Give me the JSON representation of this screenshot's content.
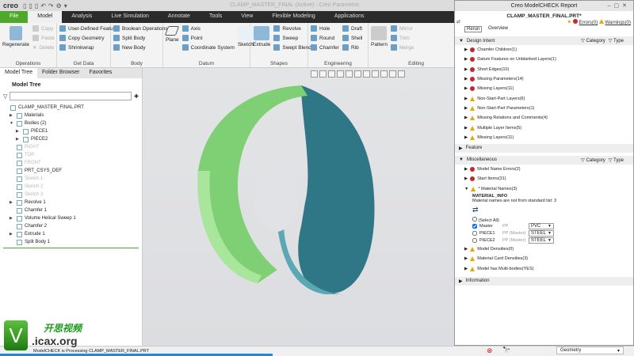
{
  "app": {
    "logo": "creo",
    "window_title": "CLAMP_MASTER_FINAL (Active) - Creo Parametric"
  },
  "tabs": [
    "File",
    "Model",
    "Analysis",
    "Live Simulation",
    "Annotate",
    "Tools",
    "View",
    "Flexible Modeling",
    "Applications"
  ],
  "ribbon": {
    "operations": {
      "label": "Operations",
      "regenerate": "Regenerate",
      "copy": "Copy",
      "paste": "Paste",
      "delete": "Delete"
    },
    "get_data": {
      "label": "Get Data",
      "items": [
        "User-Defined Feature",
        "Copy Geometry",
        "Shrinkwrap"
      ]
    },
    "body": {
      "label": "Body",
      "items": [
        "Boolean Operations",
        "Split Body",
        "New Body"
      ]
    },
    "datum": {
      "label": "Datum",
      "plane": "Plane",
      "items": [
        "Axis",
        "Point",
        "Coordinate System"
      ],
      "sketch": "Sketch"
    },
    "shapes": {
      "label": "Shapes",
      "extrude": "Extrude",
      "items": [
        "Revolve",
        "Sweep",
        "Swept Blend"
      ]
    },
    "engineering": {
      "label": "Engineering",
      "col1": [
        "Hole",
        "Round",
        "Chamfer"
      ],
      "col2": [
        "Draft",
        "Shell",
        "Rib"
      ]
    },
    "editing": {
      "label": "Editing",
      "pattern": "Pattern",
      "items": [
        "Mirror",
        "Trim",
        "Merge"
      ]
    }
  },
  "panel": {
    "tabs": [
      "Model Tree",
      "Folder Browser",
      "Favorites"
    ],
    "title": "Model Tree",
    "filter_placeholder": "",
    "tree": [
      {
        "label": "CLAMP_MASTER_FINAL.PRT",
        "level": 0,
        "dim": false,
        "arrow": ""
      },
      {
        "label": "Materials",
        "level": 1,
        "dim": false,
        "arrow": "▶"
      },
      {
        "label": "Bodies (2)",
        "level": 1,
        "dim": false,
        "arrow": "▼"
      },
      {
        "label": "PIECE1",
        "level": 2,
        "dim": false,
        "arrow": "▶"
      },
      {
        "label": "PIECE2",
        "level": 2,
        "dim": false,
        "arrow": "▶"
      },
      {
        "label": "RIGHT",
        "level": 1,
        "dim": true,
        "arrow": ""
      },
      {
        "label": "TOP",
        "level": 1,
        "dim": true,
        "arrow": ""
      },
      {
        "label": "FRONT",
        "level": 1,
        "dim": true,
        "arrow": ""
      },
      {
        "label": "PRT_CSYS_DEF",
        "level": 1,
        "dim": false,
        "arrow": ""
      },
      {
        "label": "Sketch 1",
        "level": 1,
        "dim": true,
        "arrow": ""
      },
      {
        "label": "Sketch 2",
        "level": 1,
        "dim": true,
        "arrow": ""
      },
      {
        "label": "Sketch 3",
        "level": 1,
        "dim": true,
        "arrow": ""
      },
      {
        "label": "Revolve 1",
        "level": 1,
        "dim": false,
        "arrow": "▶"
      },
      {
        "label": "Chamfer 1",
        "level": 1,
        "dim": false,
        "arrow": ""
      },
      {
        "label": "Volume Helical Sweep 1",
        "level": 1,
        "dim": false,
        "arrow": "▶"
      },
      {
        "label": "Chamfer 2",
        "level": 1,
        "dim": false,
        "arrow": ""
      },
      {
        "label": "Extrude 1",
        "level": 1,
        "dim": false,
        "arrow": "▶"
      },
      {
        "label": "Split Body 1",
        "level": 1,
        "dim": false,
        "arrow": ""
      }
    ]
  },
  "report": {
    "title": "Creo ModelCHECK Report",
    "file": "CLAMP_MASTER_FINAL.PRT*",
    "errors": "Errors(0)",
    "warnings": "Warnings(0)",
    "rerun_tooltip": "Rerun",
    "overview": "Overview",
    "category": "Category",
    "type": "Type",
    "design_intent": {
      "label": "Design Intent",
      "items": [
        {
          "sev": "err",
          "text": "Chamfer Children(1)"
        },
        {
          "sev": "err",
          "text": "Datum Features on Unblanked Layers(1)"
        },
        {
          "sev": "err",
          "text": "Short Edges(10)"
        },
        {
          "sev": "err",
          "text": "Missing Parameters(14)"
        },
        {
          "sev": "err",
          "text": "Missing Layers(11)"
        },
        {
          "sev": "warn",
          "text": "Non-Start-Part Layers(6)"
        },
        {
          "sev": "warn",
          "text": "Non-Start-Part Parameters(1)"
        },
        {
          "sev": "warn",
          "text": "Missing Relations and Comments(4)"
        },
        {
          "sev": "warn",
          "text": "Multiple Layer Items(5)"
        },
        {
          "sev": "warn",
          "text": "Missing Layers(11)"
        }
      ]
    },
    "feature": {
      "label": "Feature"
    },
    "misc": {
      "label": "Miscellaneous",
      "items_before": [
        {
          "sev": "err",
          "text": "Model Name Errors(2)"
        },
        {
          "sev": "err",
          "text": "Start Items(31)"
        }
      ],
      "material": {
        "text": "* Material Names(3)",
        "info_title": "MATERIAL_INFO",
        "info_text": "Material names are not from standard list: 3",
        "select_all": "(Select All)",
        "rows": [
          {
            "name": "Master",
            "param": "PP",
            "value": "PVC",
            "checked": true
          },
          {
            "name": "PIECE1",
            "param": "PP (Master)",
            "value": "STEEL",
            "checked": false
          },
          {
            "name": "PIECE2",
            "param": "PP (Master)",
            "value": "STEEL",
            "checked": false
          }
        ]
      },
      "items_after": [
        {
          "sev": "warn",
          "text": "Model Densities(0)"
        },
        {
          "sev": "warn",
          "text": "Material Card Densities(3)"
        },
        {
          "sev": "warn",
          "text": "Model has Multi-bodies(YES)"
        }
      ]
    },
    "information": {
      "label": "Information"
    }
  },
  "status": {
    "message": "ModelCHECK is Processing CLAMP_MASTER_FINAL.PRT",
    "filter": "Geometry",
    "progress": 0.43
  },
  "watermark": {
    "cn": "开思视频",
    "url": ".icax.org",
    "v": "V"
  }
}
